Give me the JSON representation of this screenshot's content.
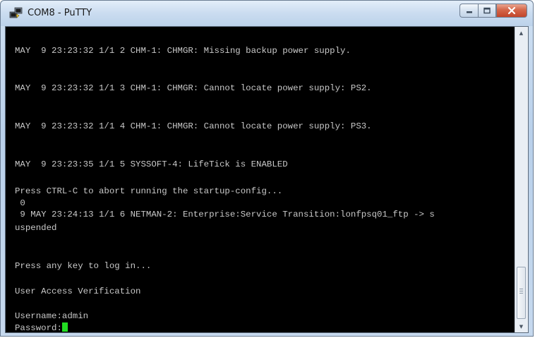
{
  "window": {
    "title": "COM8 - PuTTY",
    "controls": {
      "minimize_icon": "minimize-icon",
      "maximize_icon": "maximize-icon",
      "close_icon": "close-icon"
    }
  },
  "terminal": {
    "lines": [
      "MAY  9 23:23:32 1/1 2 CHM-1: CHMGR: Missing backup power supply.",
      "MAY  9 23:23:32 1/1 3 CHM-1: CHMGR: Cannot locate power supply: PS2.",
      "MAY  9 23:23:32 1/1 4 CHM-1: CHMGR: Cannot locate power supply: PS3.",
      "MAY  9 23:23:35 1/1 5 SYSSOFT-4: LifeTick is ENABLED",
      "Press CTRL-C to abort running the startup-config...",
      " 0",
      " 9 MAY 23:24:13 1/1 6 NETMAN-2: Enterprise:Service Transition:lonfpsq01_ftp -> s",
      "uspended",
      "Press any key to log in...",
      "User Access Verification",
      "Username:admin",
      "Password:"
    ],
    "cursor_color": "#22dd22",
    "text_color": "#c8c8c8",
    "background": "#000000"
  }
}
